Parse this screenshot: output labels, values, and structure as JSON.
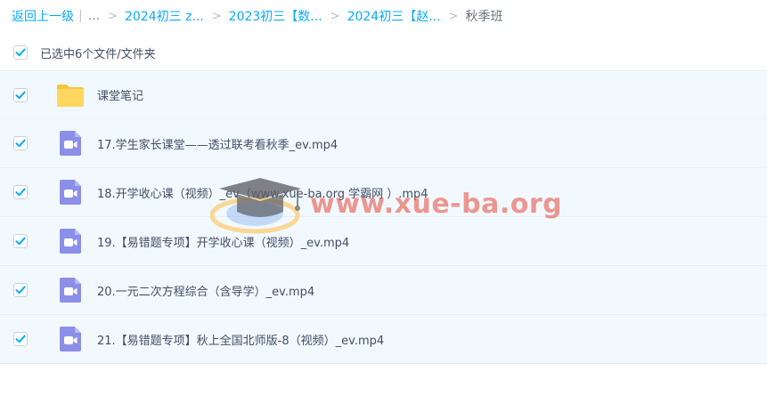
{
  "breadcrumb": {
    "back_label": "返回上一级",
    "separator": "|",
    "ellipsis": "...",
    "arrow": ">",
    "crumbs": [
      "2024初三 z...",
      "2023初三【数...",
      "2024初三【赵..."
    ],
    "current": "秋季班"
  },
  "selection": {
    "label": "已选中6个文件/文件夹",
    "checked": true
  },
  "files": [
    {
      "name": "课堂笔记",
      "type": "folder",
      "checked": true
    },
    {
      "name": "17.学生家长课堂——透过联考看秋季_ev.mp4",
      "type": "video",
      "checked": true
    },
    {
      "name": "18.开学收心课（视频）_ev（www.xue-ba.org 学霸网 ）.mp4",
      "type": "video",
      "checked": true
    },
    {
      "name": "19.【易错题专项】开学收心课（视频）_ev.mp4",
      "type": "video",
      "checked": true
    },
    {
      "name": "20.一元二次方程综合（含导学）_ev.mp4",
      "type": "video",
      "checked": true
    },
    {
      "name": "21.【易错题专项】秋上全国北师版-8（视频）_ev.mp4",
      "type": "video",
      "checked": true
    }
  ],
  "watermark": {
    "text": "www.xue-ba.org"
  },
  "colors": {
    "accent": "#09aaff",
    "row_bg": "#f2f9fe",
    "folder": "#ffd45c",
    "video": "#8c8fe8",
    "check": "#09aaff"
  },
  "icons": {
    "checkbox": "check-icon",
    "folder": "folder-icon",
    "video": "video-file-icon",
    "watermark": "graduation-cap-icon"
  }
}
